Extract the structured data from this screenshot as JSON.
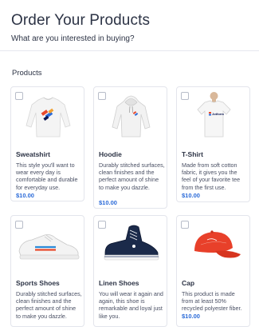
{
  "header": {
    "title": "Order Your Products",
    "subtitle": "What are you interested in buying?"
  },
  "products_section": {
    "label": "Products",
    "items": [
      {
        "name": "Sweatshirt",
        "description": "This style you'll want to wear every day is comfortable and durable for everyday use.",
        "price": "$10.00",
        "icon": "sweatshirt-icon",
        "selected": false
      },
      {
        "name": "Hoodie",
        "description": "Durably stitched surfaces, clean finishes and the perfect amount of shine to make you dazzle.",
        "price": "$10.00",
        "icon": "hoodie-icon",
        "selected": false
      },
      {
        "name": "T-Shirt",
        "description": "Made from soft cotton fabric, it gives you the feel of your favorite tee from the first use.",
        "price": "$10.00",
        "icon": "tshirt-icon",
        "selected": false
      },
      {
        "name": "Sports Shoes",
        "description": "Durably stitched surfaces, clean finishes and the perfect amount of shine to make you dazzle.",
        "price": "",
        "icon": "sports-shoes-icon",
        "selected": false
      },
      {
        "name": "Linen Shoes",
        "description": "You will wear it again and again, this shoe is remarkable and loyal just like you.",
        "price": "",
        "icon": "linen-shoes-icon",
        "selected": false
      },
      {
        "name": "Cap",
        "description": "This product is made from at least 50% recycled polyester fiber.",
        "price": "$10.00",
        "icon": "cap-icon",
        "selected": false
      }
    ],
    "tshirt_logo_text": "Jotform"
  },
  "colors": {
    "price": "#2a6ad8",
    "border": "#e3e5ec",
    "text": "#2c3345",
    "cap": "#e8402a"
  }
}
